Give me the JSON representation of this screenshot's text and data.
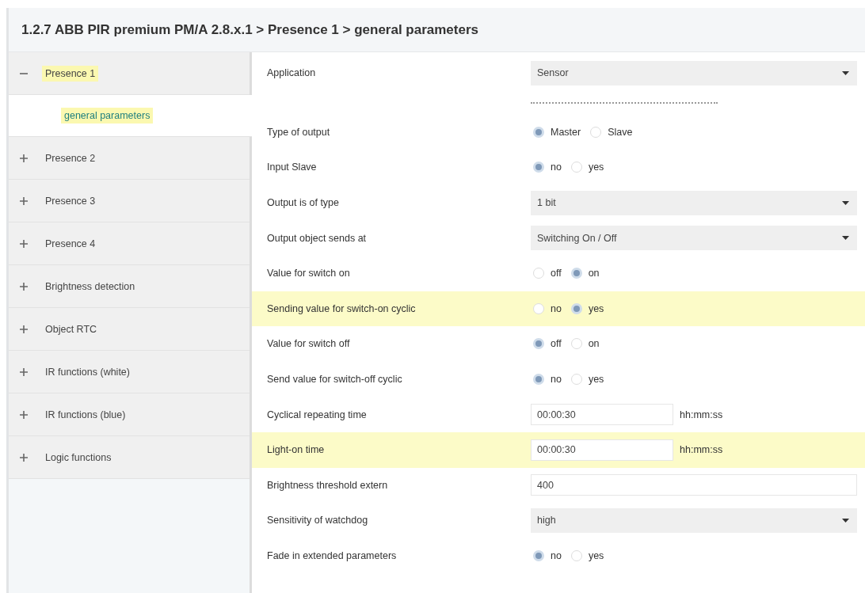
{
  "window": {
    "title": "1.2.7 ABB PIR premium PM/A 2.8.x.1 > Presence 1 > general parameters"
  },
  "sidebar": {
    "items": [
      {
        "label": "Presence 1",
        "expanded": true,
        "highlighted": true,
        "selected": false,
        "children": [
          {
            "label": "general parameters",
            "highlighted": true,
            "selected": true
          }
        ]
      },
      {
        "label": "Presence 2",
        "expanded": false,
        "highlighted": false,
        "selected": false
      },
      {
        "label": "Presence 3",
        "expanded": false,
        "highlighted": false,
        "selected": false
      },
      {
        "label": "Presence 4",
        "expanded": false,
        "highlighted": false,
        "selected": false
      },
      {
        "label": "Brightness detection",
        "expanded": false,
        "highlighted": false,
        "selected": false
      },
      {
        "label": "Object RTC",
        "expanded": false,
        "highlighted": false,
        "selected": false
      },
      {
        "label": "IR functions (white)",
        "expanded": false,
        "highlighted": false,
        "selected": false
      },
      {
        "label": "IR functions (blue)",
        "expanded": false,
        "highlighted": false,
        "selected": false
      },
      {
        "label": "Logic functions",
        "expanded": false,
        "highlighted": false,
        "selected": false
      }
    ]
  },
  "parameters": [
    {
      "kind": "dropdown",
      "label": "Application",
      "value": "Sensor",
      "highlighted": false
    },
    {
      "kind": "separator"
    },
    {
      "kind": "radio",
      "label": "Type of output",
      "highlighted": false,
      "options": [
        {
          "label": "Master",
          "selected": true
        },
        {
          "label": "Slave",
          "selected": false
        }
      ]
    },
    {
      "kind": "radio",
      "label": "Input Slave",
      "highlighted": false,
      "options": [
        {
          "label": "no",
          "selected": true
        },
        {
          "label": "yes",
          "selected": false
        }
      ]
    },
    {
      "kind": "dropdown",
      "label": "Output is of type",
      "value": "1 bit",
      "highlighted": false
    },
    {
      "kind": "dropdown",
      "label": "Output object sends at",
      "value": "Switching On / Off",
      "highlighted": false
    },
    {
      "kind": "radio",
      "label": "Value for switch on",
      "highlighted": false,
      "options": [
        {
          "label": "off",
          "selected": false
        },
        {
          "label": "on",
          "selected": true
        }
      ]
    },
    {
      "kind": "radio",
      "label": "Sending value for switch-on cyclic",
      "highlighted": true,
      "options": [
        {
          "label": "no",
          "selected": false
        },
        {
          "label": "yes",
          "selected": true
        }
      ]
    },
    {
      "kind": "radio",
      "label": "Value for switch off",
      "highlighted": false,
      "options": [
        {
          "label": "off",
          "selected": true
        },
        {
          "label": "on",
          "selected": false
        }
      ]
    },
    {
      "kind": "radio",
      "label": "Send value for switch-off cyclic",
      "highlighted": false,
      "options": [
        {
          "label": "no",
          "selected": true
        },
        {
          "label": "yes",
          "selected": false
        }
      ]
    },
    {
      "kind": "time",
      "label": "Cyclical repeating time",
      "value": "00:00:30",
      "unit": "hh:mm:ss",
      "highlighted": false
    },
    {
      "kind": "time",
      "label": "Light-on time",
      "value": "00:00:30",
      "unit": "hh:mm:ss",
      "highlighted": true
    },
    {
      "kind": "text",
      "label": "Brightness threshold extern",
      "value": "400",
      "highlighted": false
    },
    {
      "kind": "dropdown",
      "label": "Sensitivity of watchdog",
      "value": "high",
      "highlighted": false
    },
    {
      "kind": "radio",
      "label": "Fade in extended parameters",
      "highlighted": false,
      "options": [
        {
          "label": "no",
          "selected": true
        },
        {
          "label": "yes",
          "selected": false
        }
      ]
    }
  ]
}
